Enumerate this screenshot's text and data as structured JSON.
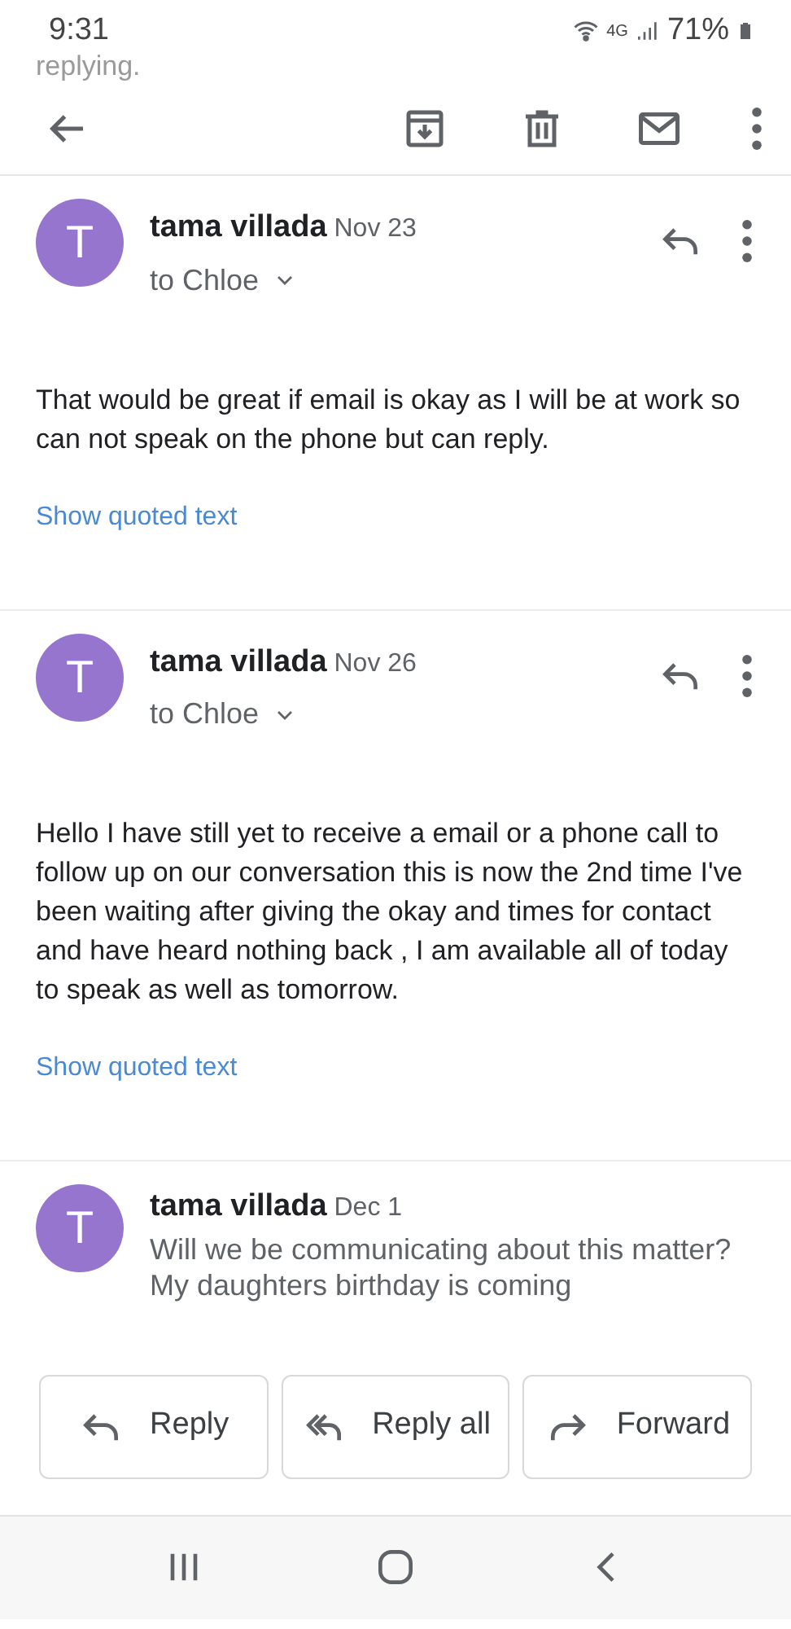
{
  "status_bar": {
    "time": "9:31",
    "network": "4G",
    "battery": "71%"
  },
  "banner_fragment": "replying.",
  "messages": [
    {
      "avatar": "T",
      "sender": "tama villada",
      "date": "Nov 23",
      "recipient": "to Chloe",
      "expanded": true,
      "body": "That would be great if email is okay as I will be at work so can not speak on the phone but can reply.",
      "quoted_link": "Show quoted text"
    },
    {
      "avatar": "T",
      "sender": "tama villada",
      "date": "Nov 26",
      "recipient": "to Chloe",
      "expanded": true,
      "body": "Hello I have still yet to receive a email or a phone call to follow up on our conversation this is now the 2nd time I've been waiting after giving the okay and times for contact and have heard nothing back , I am available all of today to speak as well as tomorrow.",
      "quoted_link": "Show quoted text"
    },
    {
      "avatar": "T",
      "sender": "tama villada",
      "date": "Dec 1",
      "expanded": false,
      "snippet": "Will we be communicating about this matter? My daughters birthday is coming"
    }
  ],
  "actions": [
    {
      "kind": "reply",
      "label": "Reply"
    },
    {
      "kind": "reply_all",
      "label": "Reply all"
    },
    {
      "kind": "forward",
      "label": "Forward"
    }
  ]
}
